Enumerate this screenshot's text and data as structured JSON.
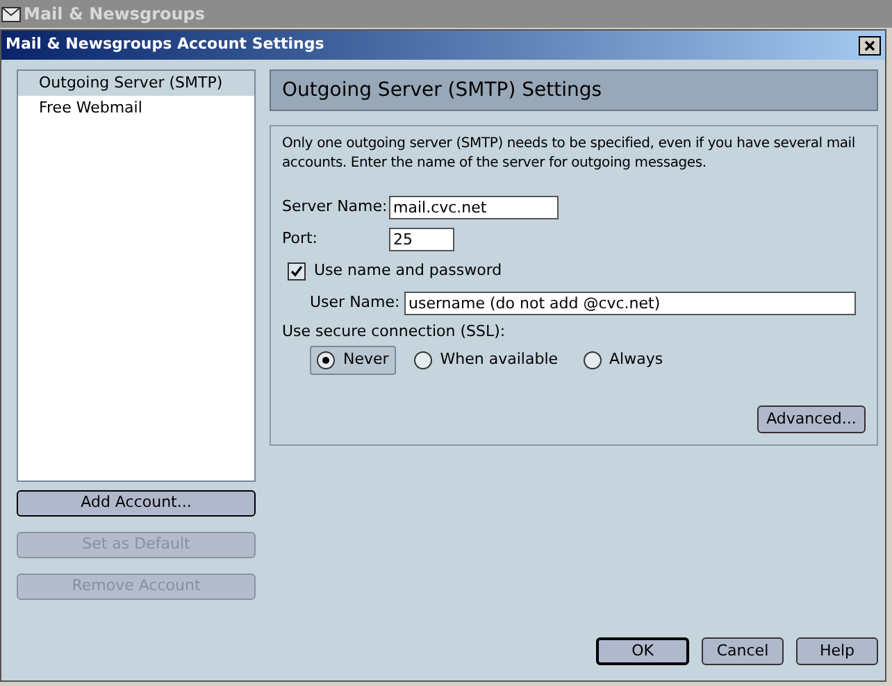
{
  "background_window": {
    "title": "Mail & Newsgroups"
  },
  "dialog": {
    "title": "Mail & Newsgroups Account Settings"
  },
  "accounts": [
    {
      "label": "Outgoing Server (SMTP)",
      "selected": true
    },
    {
      "label": "Free Webmail",
      "selected": false
    }
  ],
  "account_buttons": [
    {
      "label": "Add Account...",
      "disabled": false
    },
    {
      "label": "Set as Default",
      "disabled": true
    },
    {
      "label": "Remove Account",
      "disabled": true
    }
  ],
  "panel": {
    "title": "Outgoing Server (SMTP) Settings",
    "description": "Only one outgoing server (SMTP) needs to be specified, even if you have several mail accounts. Enter the name of the server for outgoing messages.",
    "server_name": {
      "label": "Server Name:",
      "value": "mail.cvc.net"
    },
    "port": {
      "label": "Port:",
      "value": "25"
    },
    "use_password": {
      "label": "Use name and password",
      "checked": true
    },
    "user_name": {
      "label": "User Name:",
      "value": "username (do not add @cvc.net)"
    },
    "ssl": {
      "label": "Use secure connection (SSL):",
      "options": [
        {
          "label": "Never",
          "selected": true
        },
        {
          "label": "When available",
          "selected": false
        },
        {
          "label": "Always",
          "selected": false
        }
      ]
    },
    "advanced_button": "Advanced..."
  },
  "dialog_buttons": [
    {
      "label": "OK",
      "default": true
    },
    {
      "label": "Cancel",
      "default": false
    },
    {
      "label": "Help",
      "default": false
    }
  ]
}
